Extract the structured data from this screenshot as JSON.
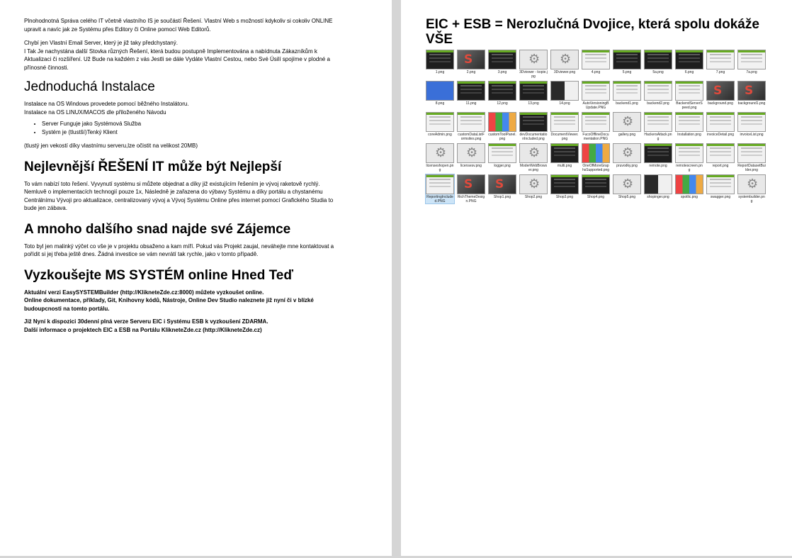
{
  "left": {
    "intro_p1": [
      "Plnohodnotná Správa celého IT včetně vlastního IS je součástí Řešení. Vlastní Web s možností kdykoliv si cokoliv ONLINE",
      "upravit a navíc jak ze Systému přes Editory či Online pomocí Web Editorů."
    ],
    "intro_p2": [
      "Chybí jen Vlastní Email Server, který je již taky předchystaný.",
      "I Tak Je nachystána další Stovka různých Řešení, která budou postupně Implementována a nabídnuta Zákazníkům k",
      "Aktualizaci či rozšíření. Už Bude na každém z vás Jestli se dále Vydáte Vlastní Cestou, nebo Své Úsilí spojíme v plodné a",
      "přínosné činnosti."
    ],
    "h_install": "Jednoduchá Instalace",
    "install_lines": [
      "Instalace na OS Windows provedete pomocí běžného Instalátoru.",
      "Instalace na OS LINUX/MACOS dle přiloženého Návodu"
    ],
    "install_bullets": [
      "Server Funguje jako Systémová Služba",
      "Systém je (tlustší)Tenký Klient"
    ],
    "install_note": "(tlustý jen vekostí díky vlastnímu serveru,lze očistit na velikost 20MB)",
    "h_cheap": "Nejlevnější ŘEŠENÍ IT může být Nejlepší",
    "cheap_lines": [
      "To vám nabízí toto řešení. Vyvynutí systému si můžete objednat a díky již existujícím řešením je vývoj raketově rychlý.",
      "Nemluvě o implementacích technogií pouze 1x, Následně je zařazena do výbavy Systému a díky portálu a chystanému",
      "Centrálnímu Vývoji pro aktualizace, centralizovaný vývoj a Vývoj Systému Online přes internet pomocí Grafického Studia to",
      "bude jen zábava."
    ],
    "h_more": "A mnoho dalšího snad najde své Zájemce",
    "more_lines": [
      "Toto byl jen malinký výčet co vše je v projektu obsaženo a kam míří. Pokud vás Projekt zaujal, neváhejte mne kontaktovat a",
      "pořídit si jej třeba ještě dnes. Žádná investice se vám nevrátí tak rychle, jako v tomto případě."
    ],
    "h_try": "Vyzkoušejte MS SYSTÉM online Hned Teď",
    "try_p1": [
      "Aktuální verzi EasySYSTEMBuilder (http://KlikneteZde.cz:8000) můžete vyzkoušet online.",
      "Online dokumentace, příklady, Git, Knihovny kódů, Nástroje, Online Dev Studio naleznete již nyní či v blízké",
      "budoupcnosti na tomto portálu."
    ],
    "try_p2": [
      "Již Nyní k dispozici 30denní plná verze Serveru EIC i Systému ESB k vyzkoušení ZDARMA.",
      "Další informace o projektech EIC a ESB na Portálu KlikneteZde.cz (http://KlikneteZde.cz)"
    ]
  },
  "right": {
    "title": [
      "EIC + ESB = Nerozlučná Dvojice, která spolu dokáže",
      "VŠE"
    ],
    "thumbnails": [
      {
        "caption": "1.png",
        "style": "dark"
      },
      {
        "caption": "2.png",
        "style": "logo"
      },
      {
        "caption": "3.png",
        "style": "dark"
      },
      {
        "caption": "3Dviewer - kopie.jpg",
        "style": "gears"
      },
      {
        "caption": "3Dviewer.png",
        "style": "gears"
      },
      {
        "caption": "4.png",
        "style": "light"
      },
      {
        "caption": "5.png",
        "style": "dark"
      },
      {
        "caption": "5a.png",
        "style": "dark"
      },
      {
        "caption": "6.png",
        "style": "dark"
      },
      {
        "caption": "7.png",
        "style": "light"
      },
      {
        "caption": "7a.png",
        "style": "light"
      },
      {
        "caption": "8.png",
        "style": "blue"
      },
      {
        "caption": "11.png",
        "style": "dark"
      },
      {
        "caption": "12.png",
        "style": "dark"
      },
      {
        "caption": "13.png",
        "style": "dark"
      },
      {
        "caption": "14.png",
        "style": "mixed"
      },
      {
        "caption": "AutoVersioningBUpdate.PNG",
        "style": "light"
      },
      {
        "caption": "backend1.png",
        "style": "light"
      },
      {
        "caption": "backend2.png",
        "style": "light"
      },
      {
        "caption": "BackendServerSpeed.png",
        "style": "light"
      },
      {
        "caption": "background.png",
        "style": "logo"
      },
      {
        "caption": "background1.png",
        "style": "logo"
      },
      {
        "caption": "coreAdmin.png",
        "style": "light"
      },
      {
        "caption": "customDataListFormsites.png",
        "style": "light"
      },
      {
        "caption": "customToolPanel.png",
        "style": "colorful"
      },
      {
        "caption": "devDocumentationIncluded.png",
        "style": "dark"
      },
      {
        "caption": "DocumentViewer.png",
        "style": "light"
      },
      {
        "caption": "FucoOfflineDocumentation.PNG",
        "style": "light"
      },
      {
        "caption": "gallery.png",
        "style": "gears"
      },
      {
        "caption": "HackersAttack.png",
        "style": "light"
      },
      {
        "caption": "Installation.png",
        "style": "light"
      },
      {
        "caption": "invoiceDetail.png",
        "style": "light"
      },
      {
        "caption": "invoiceList.png",
        "style": "light"
      },
      {
        "caption": "licenseshopen.png",
        "style": "gears"
      },
      {
        "caption": "licensesv.png",
        "style": "gears"
      },
      {
        "caption": "logger.png",
        "style": "light"
      },
      {
        "caption": "ModerWebBrowser.png",
        "style": "gears"
      },
      {
        "caption": "multi.png",
        "style": "dark"
      },
      {
        "caption": "OneOfMoreGraphsSupported.png",
        "style": "colorful"
      },
      {
        "caption": "pruvodky.png",
        "style": "gears"
      },
      {
        "caption": "remote.png",
        "style": "dark"
      },
      {
        "caption": "remotescreen.png",
        "style": "light"
      },
      {
        "caption": "report.png",
        "style": "light"
      },
      {
        "caption": "ReportDatasetBuilder.png",
        "style": "light"
      },
      {
        "caption": "ReportingIncluded.PNG",
        "style": "light",
        "selected": true
      },
      {
        "caption": "RichThemeDesign.PNG",
        "style": "logo"
      },
      {
        "caption": "Shop1.png",
        "style": "logo"
      },
      {
        "caption": "Shop2.png",
        "style": "gears"
      },
      {
        "caption": "Shop3.png",
        "style": "dark"
      },
      {
        "caption": "Shop4.png",
        "style": "dark"
      },
      {
        "caption": "Shop5.png",
        "style": "gears"
      },
      {
        "caption": "shopinger.png",
        "style": "mixed"
      },
      {
        "caption": "spotlic.png",
        "style": "colorful"
      },
      {
        "caption": "swagger.png",
        "style": "light"
      },
      {
        "caption": "systembuilder.png",
        "style": "gears"
      }
    ]
  }
}
